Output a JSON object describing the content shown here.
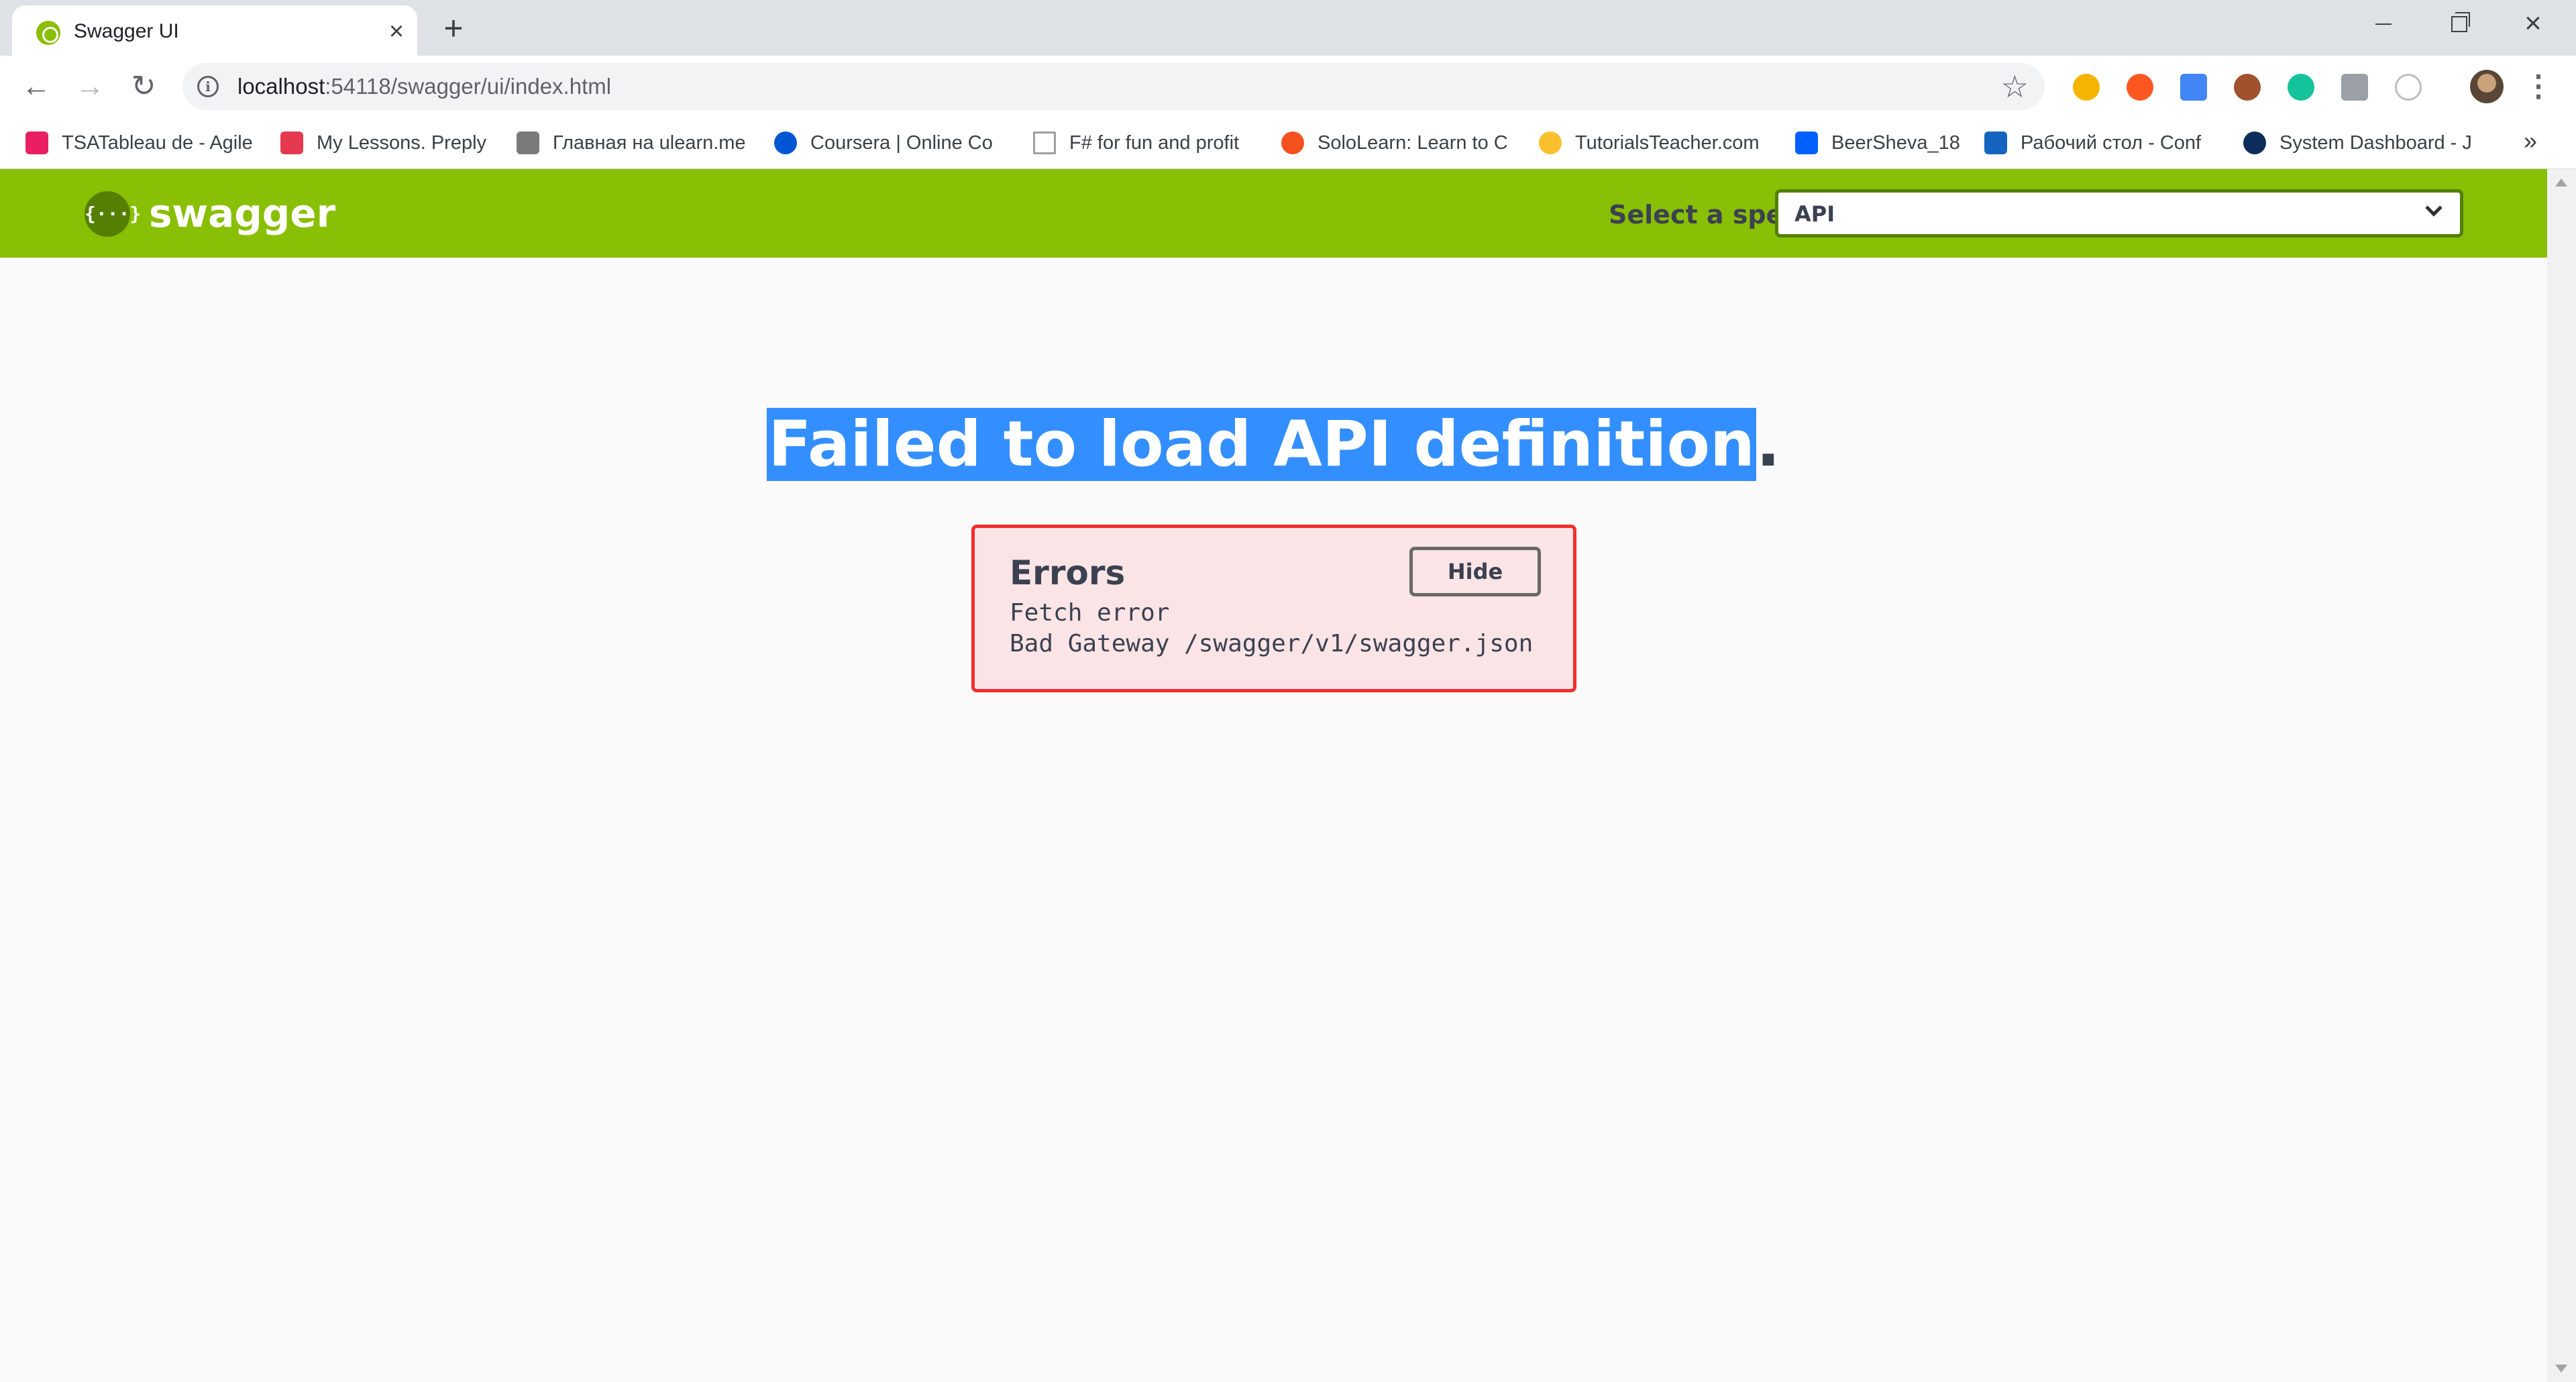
{
  "browser": {
    "tab": {
      "title": "Swagger UI"
    },
    "new_tab_label": "+",
    "omnibox": {
      "host": "localhost",
      "path": ":54118/swagger/ui/index.html"
    },
    "bookmarks": [
      {
        "label": "TSATableau de - Agile",
        "icon_color": "#e91e63"
      },
      {
        "label": "My Lessons. Preply",
        "icon_color": "#e53950"
      },
      {
        "label": "Главная на ulearn.me",
        "icon_color": "#7a7a7a"
      },
      {
        "label": "Coursera | Online Co",
        "icon_color": "#0056d2"
      },
      {
        "label": "F# for fun and profit",
        "icon_color": "#9e9e9e"
      },
      {
        "label": "SoloLearn: Learn to C",
        "icon_color": "#f4511e"
      },
      {
        "label": "TutorialsTeacher.com",
        "icon_color": "#fbc02d"
      },
      {
        "label": "BeerSheva_18",
        "icon_color": "#0061fe"
      },
      {
        "label": "Рабочий стол - Conf",
        "icon_color": "#1565c0"
      },
      {
        "label": "System Dashboard - J",
        "icon_color": "#0d2e5a"
      }
    ],
    "bookmarks_more": "»"
  },
  "swagger": {
    "logo_mark": "{···}",
    "logo_text": "swagger",
    "select_label": "Select a spec",
    "selected_spec": "API"
  },
  "main": {
    "title_selected": "Failed to load API definition",
    "title_rest": ".",
    "errors": {
      "heading": "Errors",
      "hide_label": "Hide",
      "lines": [
        "Fetch error",
        "Bad Gateway /swagger/v1/swagger.json"
      ]
    }
  },
  "colors": {
    "topbar": "#89bf04",
    "error_border": "#f12e2e",
    "error_bg": "#fbe4e5",
    "selection": "#338fff"
  }
}
